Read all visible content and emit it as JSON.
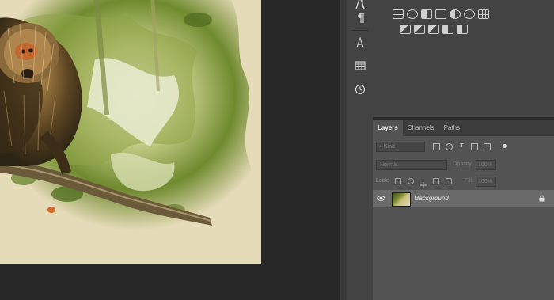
{
  "icons": {
    "dock": [
      "paragraph-icon",
      "glyphs-icon",
      "table-icon",
      "history-icon"
    ],
    "adjustments_row1": [
      "levels-icon",
      "curves-icon",
      "exposure-icon",
      "color-balance-icon",
      "photo-filter-icon",
      "channel-mixer-icon",
      "color-lookup-icon"
    ],
    "adjustments_row2": [
      "invert-icon",
      "posterize-icon",
      "threshold-icon",
      "gradient-map-icon",
      "selective-color-icon"
    ]
  },
  "layers_panel": {
    "tabs": [
      "Layers",
      "Channels",
      "Paths"
    ],
    "active_tab": "Layers",
    "filter_kind": "Kind",
    "blend_mode": "Normal",
    "opacity_label": "Opacity:",
    "opacity_value": "100%",
    "lock_label": "Lock:",
    "fill_label": "Fill:",
    "fill_value": "100%",
    "layer_name": "Background"
  },
  "colors": {
    "document_background": "#e6dbb9",
    "selected_layer_row": "#6a6a6a",
    "panel_background": "#535353"
  }
}
